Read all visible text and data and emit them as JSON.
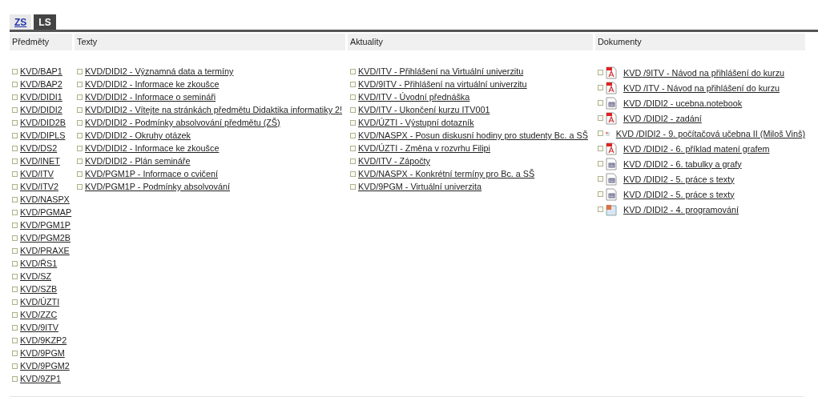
{
  "tabs": [
    {
      "label": "ZS",
      "selected": false
    },
    {
      "label": "LS",
      "selected": true
    }
  ],
  "columns": [
    {
      "heading": "Předměty",
      "kind": "plain",
      "items": [
        "KVD/BAP1",
        "KVD/BAP2",
        "KVD/DIDI1",
        "KVD/DIDI2",
        "KVD/DID2B",
        "KVD/DIPLS",
        "KVD/DS2",
        "KVD/INET",
        "KVD/ITV",
        "KVD/ITV2",
        "KVD/NASPX",
        "KVD/PGMAP",
        "KVD/PGM1P",
        "KVD/PGM2B",
        "KVD/PRAXE",
        "KVD/ŘS1",
        "KVD/SZ",
        "KVD/SZB",
        "KVD/ÚZTI",
        "KVD/ZZC",
        "KVD/9ITV",
        "KVD/9KZP2",
        "KVD/9PGM",
        "KVD/9PGM2",
        "KVD/9ZP1"
      ]
    },
    {
      "heading": "Texty",
      "kind": "plain",
      "items": [
        "KVD/DIDI2 - Významná data a termíny",
        "KVD/DIDI2 - Informace ke zkoušce",
        "KVD/DIDI2 - Informace o semináři",
        "KVD/DIDI2 - Vítejte na stránkách předmětu Didaktika informatiky 2!",
        "KVD/DIDI2 - Podmínky absolvování předmětu (ZŠ)",
        "KVD/DIDI2 - Okruhy otázek",
        "KVD/DIDI2 - Informace ke zkoušce",
        "KVD/DIDI2 - Plán semináře",
        "KVD/PGM1P - Informace o cvičení",
        "KVD/PGM1P - Podmínky absolvování"
      ]
    },
    {
      "heading": "Aktuality",
      "kind": "plain",
      "items": [
        "KVD/ITV - Přihlášení na Virtuální univerzitu",
        "KVD/9ITV - Přihlášení na virtuální univerzitu",
        "KVD/ITV - Úvodní přednáška",
        "KVD/ITV - Ukončení kurzu ITV001",
        "KVD/ÚZTI - Výstupní dotazník",
        "KVD/NASPX - Posun diskusní hodiny pro studenty Bc. a SŠ",
        "KVD/ÚZTI - Změna v rozvrhu Filipi",
        "KVD/ITV - Zápočty",
        "KVD/NASPX - Konkrétní termíny pro Bc. a SŠ",
        "KVD/9PGM - Virtuální univerzita"
      ]
    },
    {
      "heading": "Dokumenty",
      "kind": "files",
      "items": [
        {
          "kind": "pdf",
          "label": "KVD /9ITV - Návod na přihlášení do kurzu"
        },
        {
          "kind": "pdf",
          "label": "KVD /ITV - Návod na přihlášení do kurzu"
        },
        {
          "kind": "notebook",
          "label": "KVD /DIDI2 - ucebna.notebook"
        },
        {
          "kind": "pdf",
          "label": "KVD /DIDI2 - zadání"
        },
        {
          "kind": "slides",
          "label": "KVD /DIDI2 - 9. počítačová učebna II (Miloš Vinš)"
        },
        {
          "kind": "pdf",
          "label": "KVD /DIDI2 - 6. příklad matení grafem"
        },
        {
          "kind": "notebook",
          "label": "KVD /DIDI2 - 6. tabulky a grafy"
        },
        {
          "kind": "notebook",
          "label": "KVD /DIDI2 - 5. práce s texty"
        },
        {
          "kind": "notebook",
          "label": "KVD /DIDI2 - 5. práce s texty"
        },
        {
          "kind": "slides",
          "label": "KVD /DIDI2 - 4. programování"
        }
      ]
    }
  ]
}
